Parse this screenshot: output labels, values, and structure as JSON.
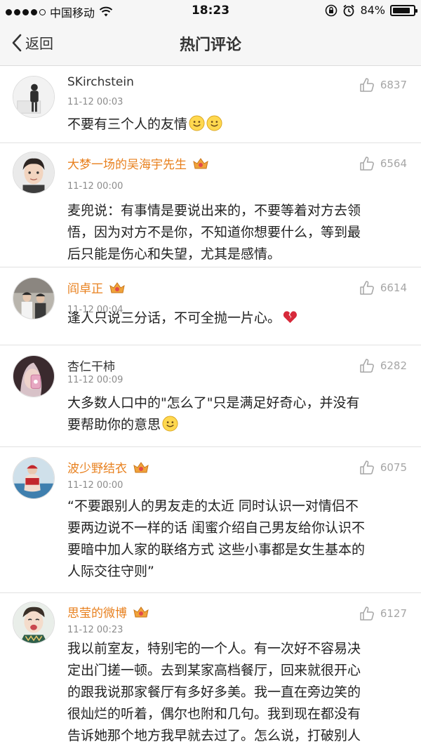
{
  "status_bar": {
    "carrier": "中国移动",
    "time": "18:23",
    "battery_percent": "84%",
    "battery_level": 0.84,
    "icons": [
      "signal-dots-icon",
      "wifi-icon",
      "orientation-lock-icon",
      "alarm-icon",
      "battery-icon"
    ]
  },
  "nav": {
    "back_label": "返回",
    "title": "热门评论"
  },
  "colors": {
    "vip_name": "#e8801e",
    "like": "#a6a6a6",
    "time": "#8c8c8c",
    "divider": "#e1e1e1"
  },
  "comments": [
    {
      "username": "SKirchstein",
      "vip": false,
      "time": "11-12 00:03",
      "likes": "6837",
      "lines": [
        "不要有三个人的友情"
      ],
      "emoji": [
        "smile-emoji",
        "smile-emoji"
      ]
    },
    {
      "username": "大梦一场的吴海宇先生",
      "vip": true,
      "time": "11-12 00:00",
      "likes": "6564",
      "lines": [
        "麦兜说：有事情是要说出来的，不要等着对方去领",
        "悟，因为对方不是你，不知道你想要什么，等到最",
        "后只能是伤心和失望，尤其是感情。"
      ],
      "emoji": []
    },
    {
      "username": "阎卓正",
      "vip": true,
      "time": "11-12 00:04",
      "likes": "6614",
      "lines": [
        "逢人只说三分话，不可全抛一片心。"
      ],
      "emoji": [
        "broken-heart-emoji"
      ]
    },
    {
      "username": "杏仁干柿",
      "vip": false,
      "time": "11-12 00:09",
      "likes": "6282",
      "lines": [
        "大多数人口中的\"怎么了\"只是满足好奇心，并没有",
        "要帮助你的意思"
      ],
      "emoji": [
        "smile-emoji"
      ]
    },
    {
      "username": "波少野结衣",
      "vip": true,
      "time": "11-12 00:00",
      "likes": "6075",
      "lines": [
        "“不要跟别人的男友走的太近 同时认识一对情侣不",
        "要两边说不一样的话 闺蜜介绍自己男友给你认识不",
        "要暗中加人家的联络方式 这些小事都是女生基本的",
        "人际交往守则”"
      ],
      "emoji": []
    },
    {
      "username": "思莹的微博",
      "vip": true,
      "time": "11-12 00:23",
      "likes": "6127",
      "lines": [
        "我以前室友，特别宅的一个人。有一次好不容易决",
        "定出门搓一顿。去到某家高档餐厅，回来就很开心",
        "的跟我说那家餐厅有多好多美。我一直在旁边笑的",
        "很灿烂的听着，偶尔也附和几句。我到现在都没有",
        "告诉她那个地方我早就去过了。怎么说，打破别人"
      ],
      "emoji": []
    }
  ]
}
